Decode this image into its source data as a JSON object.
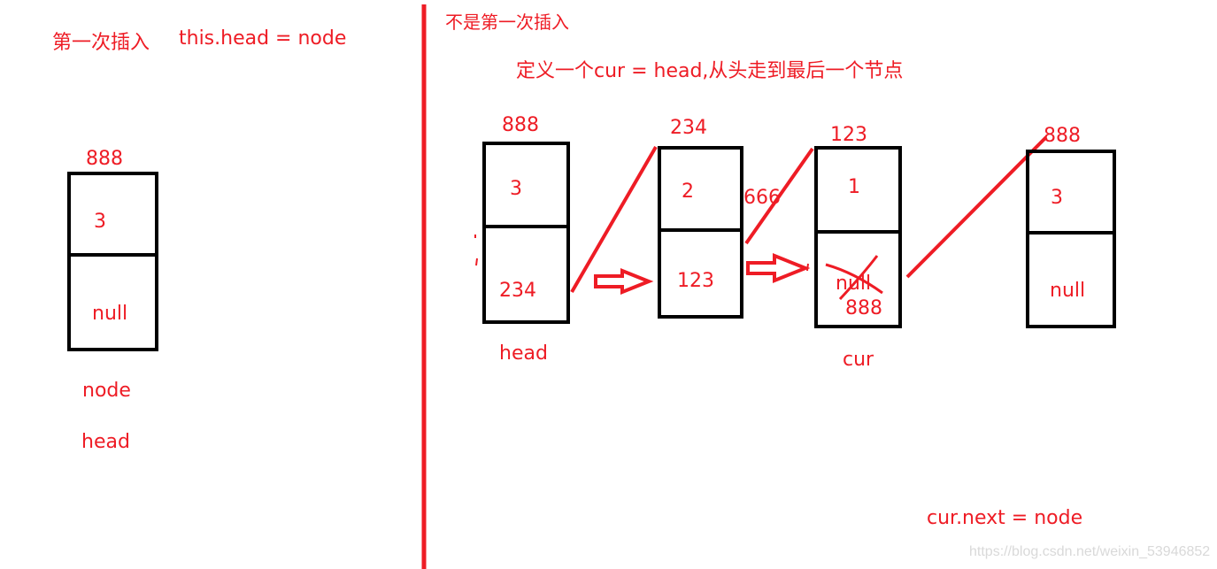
{
  "colors": {
    "ink": "#ee1c25",
    "box": "#000000",
    "watermark": "#d9d9d9",
    "background": "#ffffff"
  },
  "left_panel": {
    "title": "第一次插入",
    "code": "this.head = node",
    "node": {
      "address": "888",
      "value": "3",
      "next": "null"
    },
    "labels": [
      "node",
      "head"
    ]
  },
  "right_panel": {
    "title": "不是第一次插入",
    "description": "定义一个cur = head,从头走到最后一个节点",
    "nodes": [
      {
        "address": "888",
        "value": "3",
        "next": "234",
        "label": "head"
      },
      {
        "address": "234",
        "value": "2",
        "next": "123",
        "side_note": "666"
      },
      {
        "address": "123",
        "value": "1",
        "next_old": "null",
        "next": "888",
        "label": "cur",
        "next_old_crossed_out": true
      },
      {
        "address": "888",
        "value": "3",
        "next": "null"
      }
    ],
    "code": "cur.next = node"
  },
  "watermark": "https://blog.csdn.net/weixin_53946852"
}
